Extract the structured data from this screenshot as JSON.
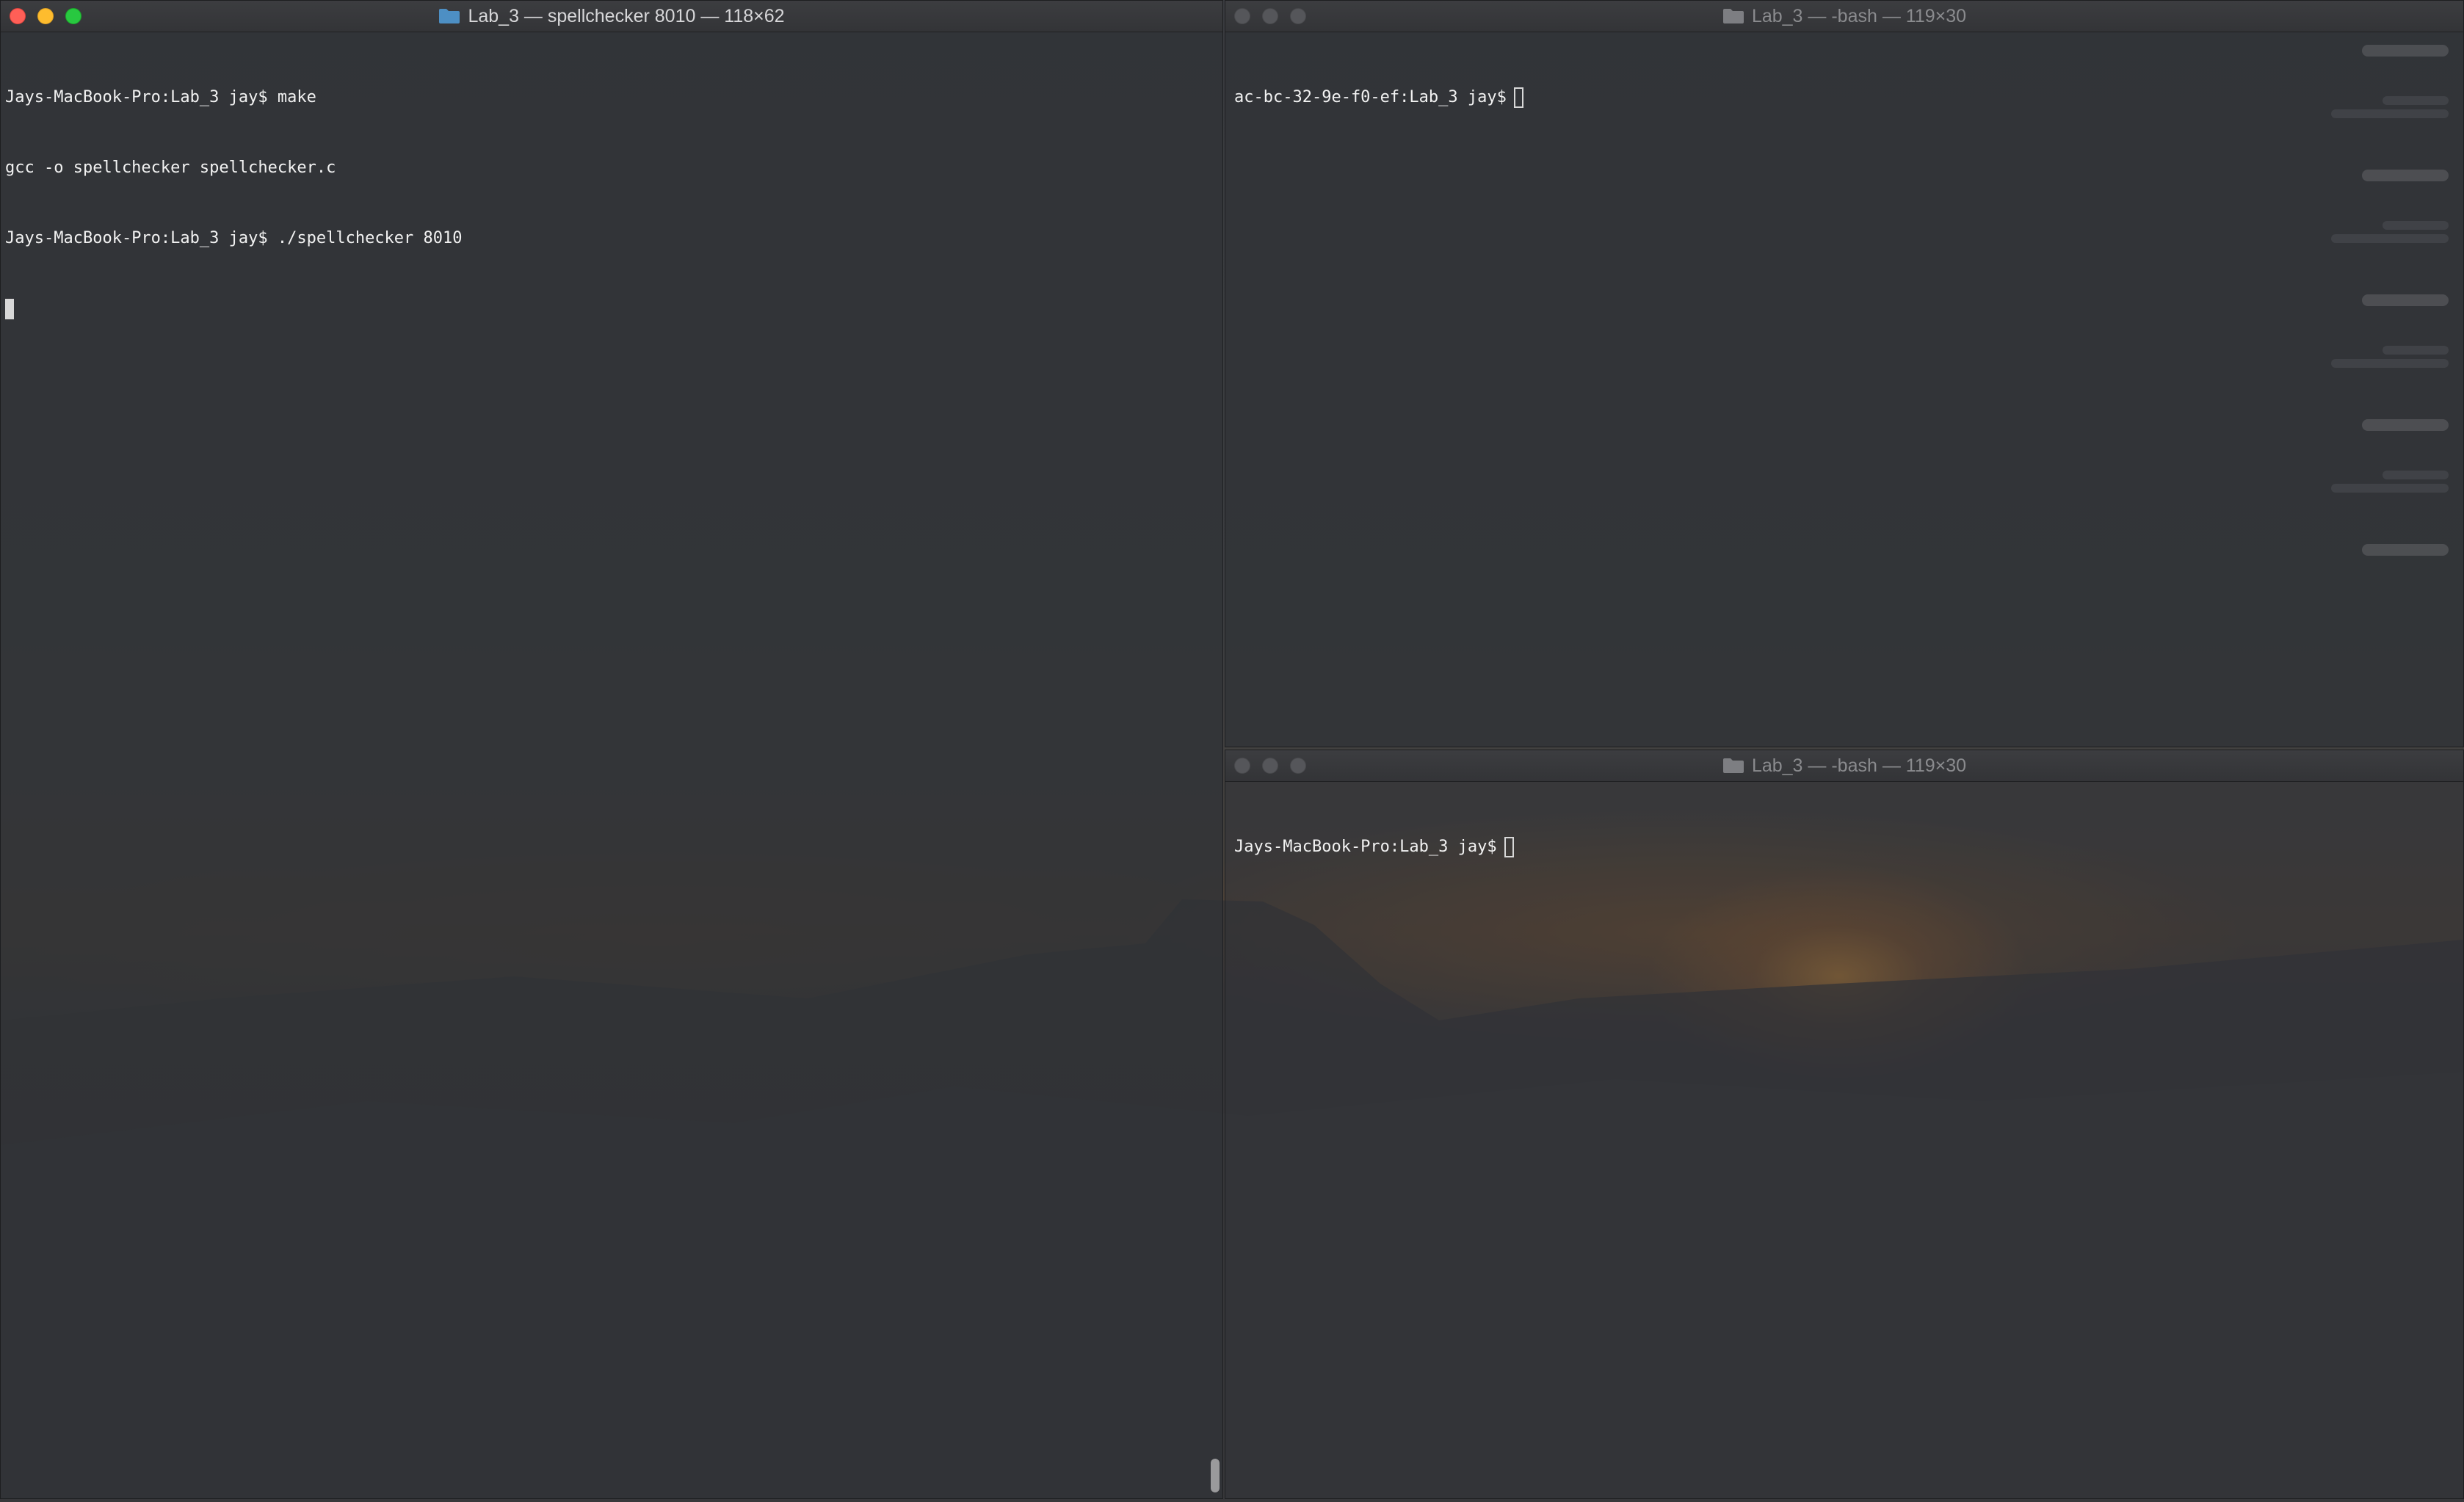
{
  "windows": {
    "left": {
      "title": "Lab_3 — spellchecker 8010 — 118×62",
      "lines": [
        "Jays-MacBook-Pro:Lab_3 jay$ make",
        "gcc -o spellchecker spellchecker.c",
        "Jays-MacBook-Pro:Lab_3 jay$ ./spellchecker 8010"
      ]
    },
    "top_right": {
      "title": "Lab_3 — -bash — 119×30",
      "prompt": "ac-bc-32-9e-f0-ef:Lab_3 jay$"
    },
    "bottom_right": {
      "title": "Lab_3 — -bash — 119×30",
      "prompt": "Jays-MacBook-Pro:Lab_3 jay$"
    }
  },
  "colors": {
    "close": "#ff5f57",
    "minimize": "#febc2e",
    "zoom": "#28c840",
    "folder_active": "#4d8fc4",
    "folder_inactive": "#7d7e82"
  }
}
